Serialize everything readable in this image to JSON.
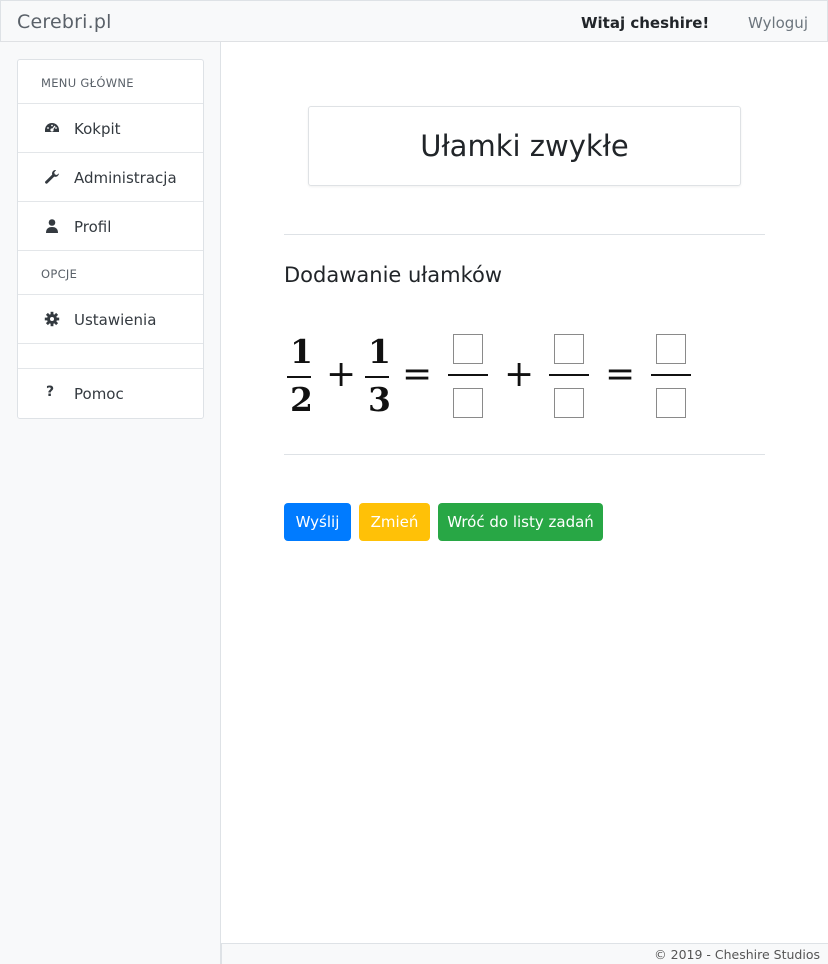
{
  "navbar": {
    "brand": "Cerebri.pl",
    "greeting": "Witaj cheshire!",
    "logout": "Wyloguj"
  },
  "sidebar": {
    "sections": [
      {
        "title": "MENU GŁÓWNE",
        "items": [
          {
            "label": "Kokpit",
            "icon": "dashboard-icon"
          },
          {
            "label": "Administracja",
            "icon": "wrench-icon"
          },
          {
            "label": "Profil",
            "icon": "user-icon"
          }
        ]
      },
      {
        "title": "OPCJE",
        "items": [
          {
            "label": "Ustawienia",
            "icon": "gear-icon"
          },
          {
            "label": "Pomoc",
            "icon": "question-icon",
            "glyph": "?"
          }
        ]
      }
    ]
  },
  "main": {
    "title": "Ułamki zwykłe",
    "subtitle": "Dodawanie ułamków",
    "equation": {
      "fraction1": {
        "numerator": "1",
        "denominator": "2"
      },
      "fraction2": {
        "numerator": "1",
        "denominator": "3"
      },
      "plus": "+",
      "equals": "="
    },
    "buttons": {
      "submit": "Wyślij",
      "change": "Zmień",
      "back": "Wróć do listy zadań"
    }
  },
  "footer": {
    "text": "© 2019 - Cheshire Studios"
  },
  "colors": {
    "primary": "#007bff",
    "warning": "#ffc107",
    "success": "#28a745",
    "sidebar_bg": "#f8f9fa"
  }
}
